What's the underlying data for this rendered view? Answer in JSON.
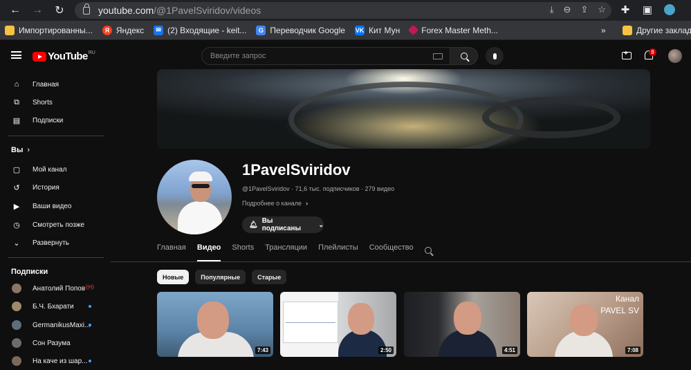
{
  "browser": {
    "url_host": "youtube.com",
    "url_path": "/@1PavelSviridov/videos",
    "bookmarks": [
      {
        "label": "Импортированны...",
        "icon": "folder-icon",
        "color": "#f5c242"
      },
      {
        "label": "Яндекс",
        "icon": "yandex-icon",
        "color": "#fc3f1d"
      },
      {
        "label": "(2) Входящие - keit...",
        "icon": "mail-icon",
        "color": "#1a73e8"
      },
      {
        "label": "Переводчик Google",
        "icon": "translate-icon",
        "color": "#4285f4"
      },
      {
        "label": "Кит Мун",
        "icon": "vk-icon",
        "color": "#0077ff"
      },
      {
        "label": "Forex Master Meth...",
        "icon": "forex-icon",
        "color": "#c2185b"
      }
    ],
    "bookmarks_more": "»",
    "bookmarks_other": "Другие заклад"
  },
  "header": {
    "logo_text": "YouTube",
    "logo_region": "RU",
    "search_placeholder": "Введите запрос",
    "notification_count": "8"
  },
  "sidebar": {
    "main": [
      {
        "label": "Главная",
        "icon": "home-icon"
      },
      {
        "label": "Shorts",
        "icon": "shorts-icon"
      },
      {
        "label": "Подписки",
        "icon": "subscriptions-icon"
      }
    ],
    "you_heading": "Вы",
    "you": [
      {
        "label": "Мой канал",
        "icon": "channel-icon"
      },
      {
        "label": "История",
        "icon": "history-icon"
      },
      {
        "label": "Ваши видео",
        "icon": "your-videos-icon"
      },
      {
        "label": "Смотреть позже",
        "icon": "watch-later-icon"
      },
      {
        "label": "Развернуть",
        "icon": "chevron-down-icon"
      }
    ],
    "subs_heading": "Подписки",
    "subs": [
      {
        "label": "Анатолий Попов",
        "status": "live"
      },
      {
        "label": "Б.Ч. Бхарати",
        "status": "new"
      },
      {
        "label": "GermanikusMaxi...",
        "status": "new"
      },
      {
        "label": "Сон Разума",
        "status": ""
      },
      {
        "label": "На каче из шар...",
        "status": "new"
      }
    ]
  },
  "channel": {
    "name": "1PavelSviridov",
    "meta": "@1PavelSviridov · 71,6 тыс. подписчиков · 279 видео",
    "more_link": "Подробнее о канале",
    "subscribed_label": "Вы подписаны"
  },
  "tabs": [
    {
      "label": "Главная",
      "active": false
    },
    {
      "label": "Видео",
      "active": true
    },
    {
      "label": "Shorts",
      "active": false
    },
    {
      "label": "Трансляции",
      "active": false
    },
    {
      "label": "Плейлисты",
      "active": false
    },
    {
      "label": "Сообщество",
      "active": false
    }
  ],
  "chips": [
    {
      "label": "Новые",
      "selected": true
    },
    {
      "label": "Популярные",
      "selected": false
    },
    {
      "label": "Старые",
      "selected": false
    }
  ],
  "videos": [
    {
      "duration": "7:43",
      "overlay_text": ""
    },
    {
      "duration": "2:50",
      "overlay_text": ""
    },
    {
      "duration": "4:51",
      "overlay_text": ""
    },
    {
      "duration": "7:08",
      "overlay_text_1": "Канал",
      "overlay_text_2": "PAVEL SV"
    }
  ]
}
